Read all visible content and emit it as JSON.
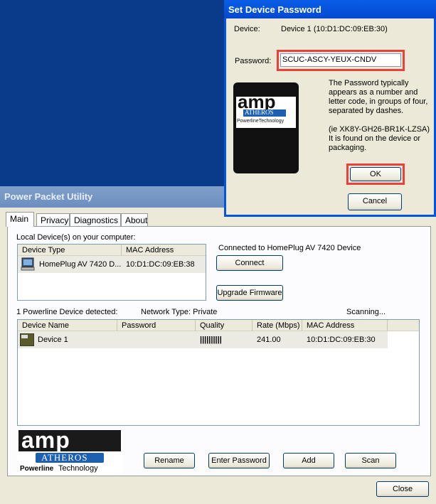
{
  "main_window": {
    "title": "Power Packet Utility",
    "tabs": [
      "Main",
      "Privacy",
      "Diagnostics",
      "About"
    ],
    "local_devices_label": "Local Device(s) on your computer:",
    "local_columns": [
      "Device Type",
      "MAC Address"
    ],
    "local_row": {
      "device_type": "HomePlug AV 7420 D...",
      "mac": "10:D1:DC:09:EB:38"
    },
    "connected_label": "Connected to HomePlug AV 7420 Device",
    "connect_button": "Connect",
    "upgrade_button": "Upgrade Firmware",
    "detected_label": "1 Powerline Device detected:",
    "network_type": "Network Type: Private",
    "scanning": "Scanning...",
    "remote_columns": [
      "Device Name",
      "Password",
      "Quality",
      "Rate (Mbps)",
      "MAC Address"
    ],
    "remote_row": {
      "name": "Device 1",
      "password": "",
      "quality": "||||||||||",
      "rate": "241.00",
      "mac": "10:D1:DC:09:EB:30"
    },
    "buttons": {
      "rename": "Rename",
      "enter_password": "Enter Password",
      "add": "Add",
      "scan": "Scan",
      "close": "Close"
    },
    "logo": {
      "brand": "amp",
      "company": "ATHEROS",
      "tagline_bold": "Powerline",
      "tagline": "Technology"
    }
  },
  "dialog": {
    "title": "Set Device Password",
    "device_label": "Device:",
    "device_value": "Device 1  (10:D1:DC:09:EB:30)",
    "password_label": "Password:",
    "password_value": "SCUC-ASCY-YEUX-CNDV",
    "help_1": "The Password typically appears as a number and letter code, in groups of four, separated by dashes.",
    "help_2": "(ie XK8Y-GH26-BR1K-LZSA) It is found on the device or packaging.",
    "ok": "OK",
    "cancel": "Cancel",
    "logo": {
      "brand": "amp",
      "company": "ATHEROS",
      "tagline": "PowerlineTechnology"
    }
  },
  "colors": {
    "highlight": "#e8423a",
    "dialog_title": "#0a5de8",
    "desktop": "#0a3a8a"
  }
}
